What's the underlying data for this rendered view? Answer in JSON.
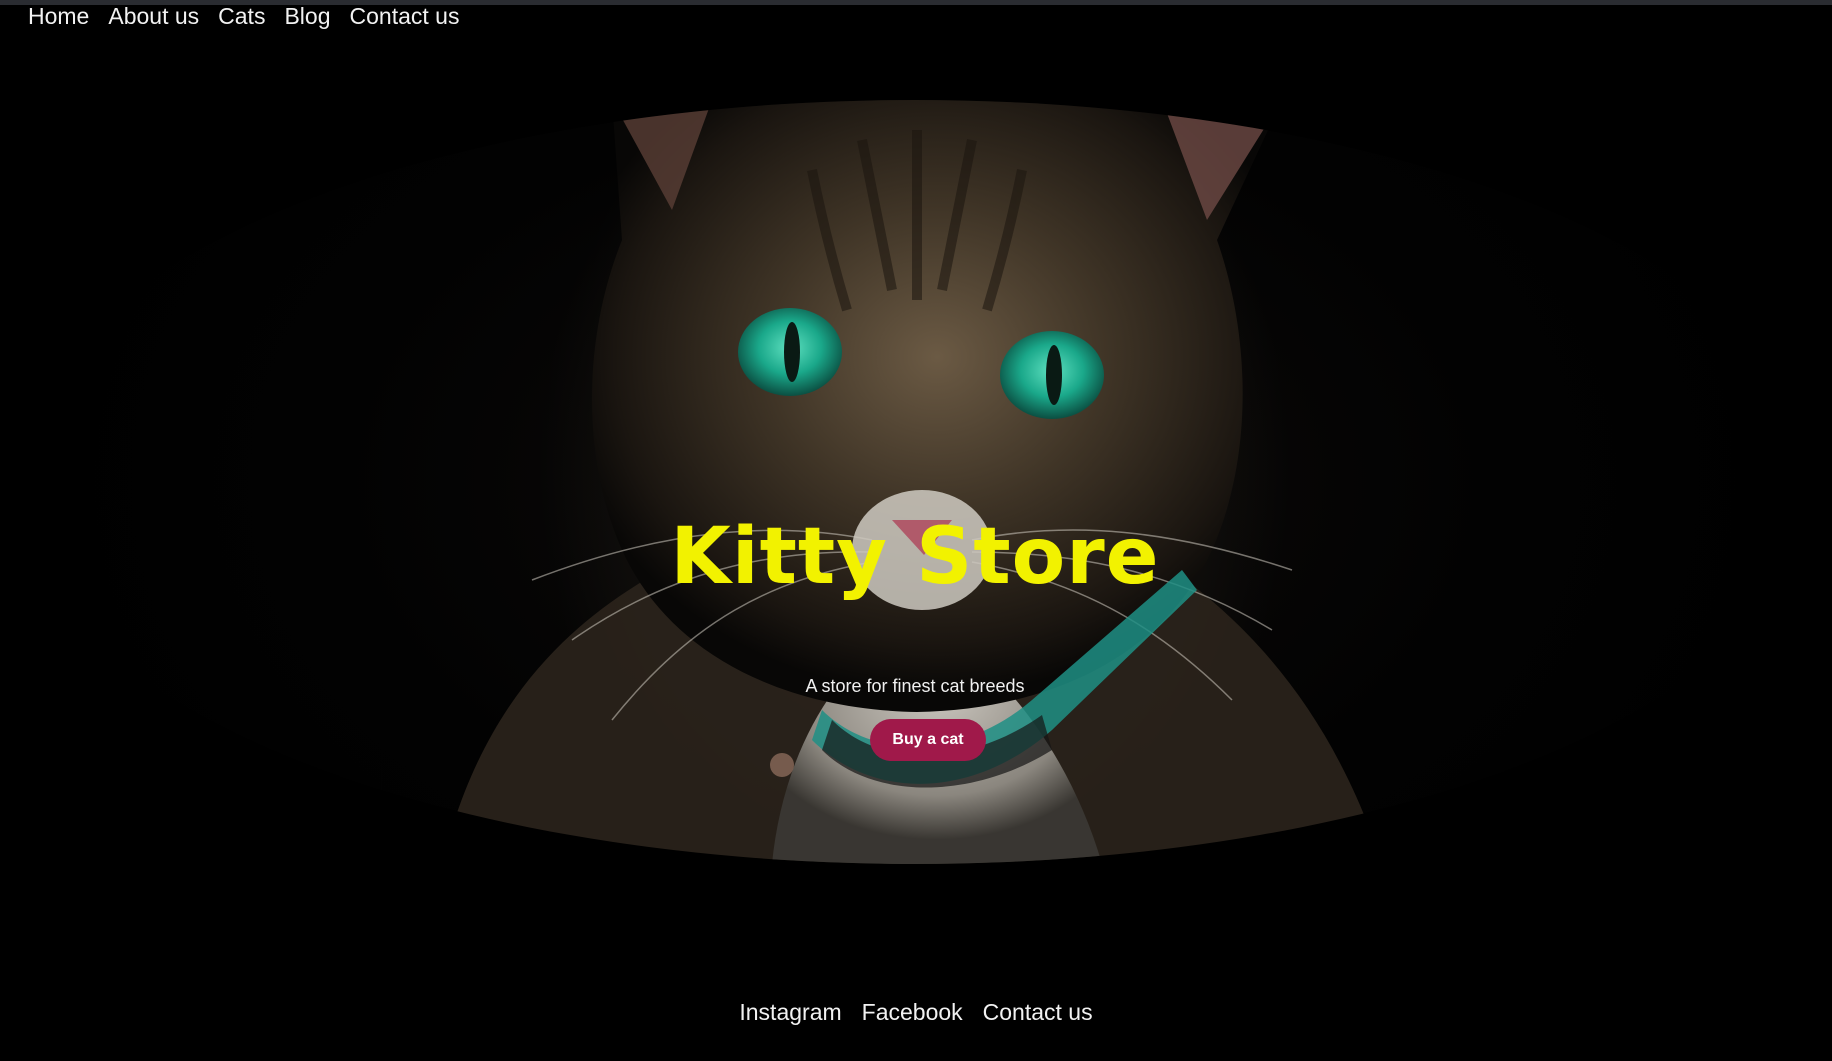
{
  "nav": {
    "items": [
      {
        "label": "Home"
      },
      {
        "label": "About us"
      },
      {
        "label": "Cats"
      },
      {
        "label": "Blog"
      },
      {
        "label": "Contact us"
      }
    ]
  },
  "hero": {
    "title": "Kitty Store",
    "subtitle": "A store for finest cat breeds",
    "cta_label": "Buy a cat",
    "title_color": "#f2f200",
    "cta_color": "#a0194a",
    "image": "tabby-cat-with-green-eyes"
  },
  "footer": {
    "links": [
      {
        "label": "Instagram"
      },
      {
        "label": "Facebook"
      },
      {
        "label": "Contact us"
      }
    ]
  }
}
